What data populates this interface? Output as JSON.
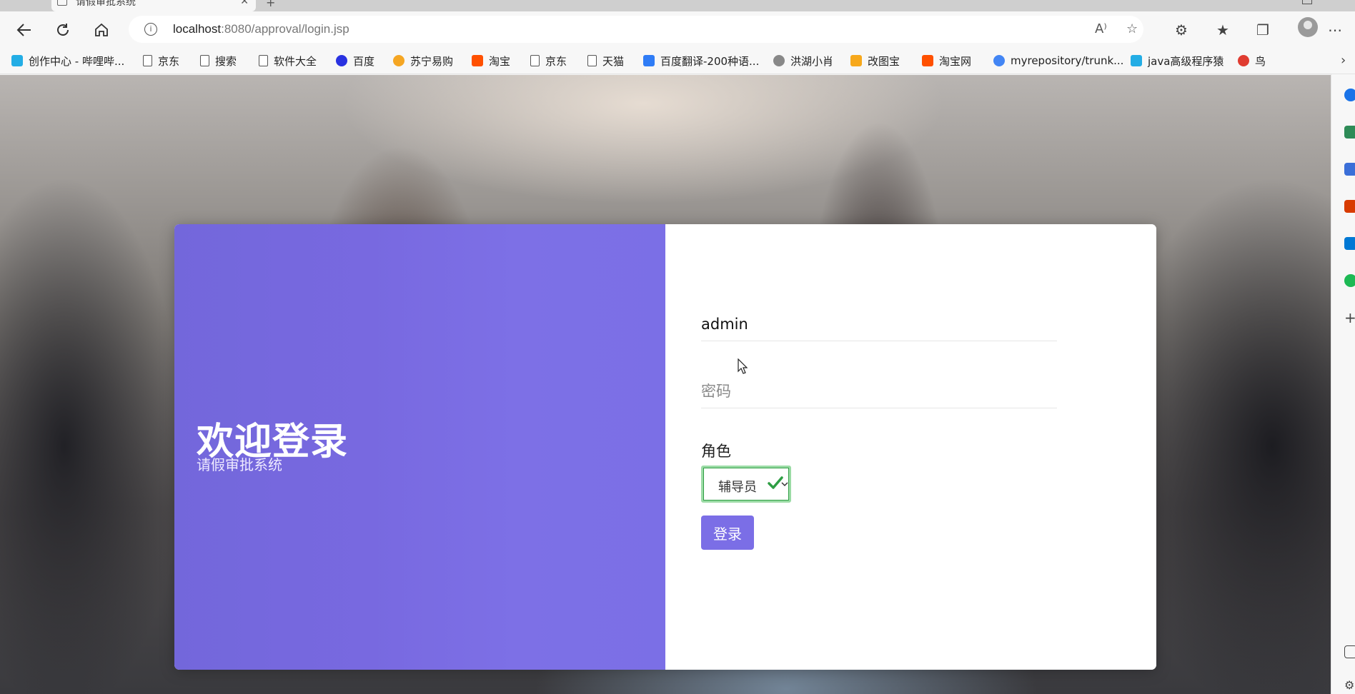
{
  "browser": {
    "tab_title": "请假审批系统",
    "url_host": "localhost",
    "url_path": ":8080/approval/login.jsp",
    "bookmarks": [
      {
        "label": "创作中心 - 哔哩哔...",
        "icon": "bilibili-icon",
        "color": "#23ade5"
      },
      {
        "label": "京东",
        "icon": "page-icon"
      },
      {
        "label": "搜索",
        "icon": "page-icon"
      },
      {
        "label": "软件大全",
        "icon": "page-icon"
      },
      {
        "label": "百度",
        "icon": "baidu-icon",
        "color": "#2932e1"
      },
      {
        "label": "苏宁易购",
        "icon": "suning-icon",
        "color": "#f5a623"
      },
      {
        "label": "淘宝",
        "icon": "taobao-icon",
        "color": "#ff5000"
      },
      {
        "label": "京东",
        "icon": "page-icon"
      },
      {
        "label": "天猫",
        "icon": "page-icon"
      },
      {
        "label": "百度翻译-200种语...",
        "icon": "translate-icon",
        "color": "#2f7cf6"
      },
      {
        "label": "洪湖小肖",
        "icon": "bird-icon",
        "color": "#888888"
      },
      {
        "label": "改图宝",
        "icon": "gaitubao-icon",
        "color": "#f7a81b"
      },
      {
        "label": "淘宝网",
        "icon": "taobao-icon",
        "color": "#ff5000"
      },
      {
        "label": "myrepository/trunk...",
        "icon": "chrome-icon",
        "color": "#4285f4"
      },
      {
        "label": "java高级程序猿",
        "icon": "bilibili-icon",
        "color": "#23ade5"
      },
      {
        "label": "鸟",
        "icon": "bird-icon",
        "color": "#e03c31"
      }
    ]
  },
  "login": {
    "welcome_title": "欢迎登录",
    "subtitle": "请假审批系统",
    "username_value": "admin",
    "password_placeholder": "密码",
    "role_label": "角色",
    "role_selected": "辅导员",
    "submit_label": "登录"
  },
  "colors": {
    "panel_purple": "#7869e0",
    "button_purple": "#7b6ee6",
    "select_border_green": "#2f9e44"
  }
}
